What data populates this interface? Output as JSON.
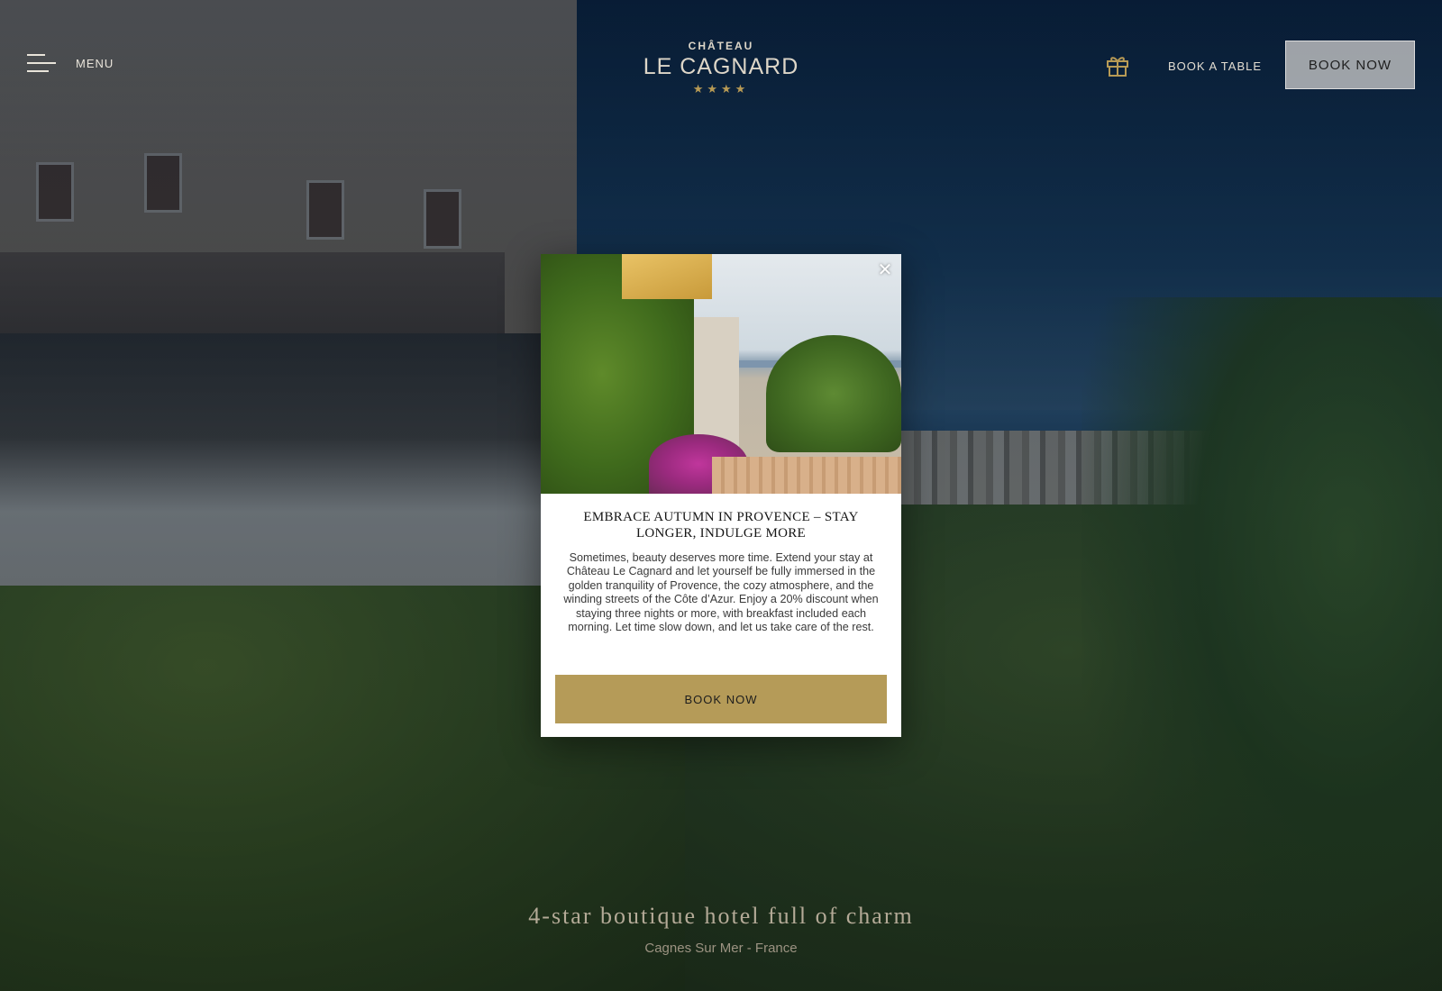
{
  "header": {
    "menu_label": "MENU",
    "logo": {
      "top": "CHÂTEAU",
      "main": "LE CAGNARD",
      "stars": "★★★★"
    },
    "gift_icon": "gift-icon",
    "book_table_label": "BOOK A TABLE",
    "book_now_label": "BOOK NOW"
  },
  "hero": {
    "title": "4-star boutique hotel full of charm",
    "subtitle": "Cagnes Sur Mer - France"
  },
  "modal": {
    "close_glyph": "✕",
    "title": "EMBRACE AUTUMN IN PROVENCE – STAY LONGER, INDULGE MORE",
    "body": "Sometimes, beauty deserves more time. Extend your stay at Château Le Cagnard and let yourself be fully immersed in the golden tranquility of Provence, the cozy atmosphere, and the winding streets of the Côte d’Azur. Enjoy a 20% discount when staying three nights or more, with breakfast included each morning. Let time slow down, and let us take care of the rest.",
    "cta_label": "BOOK NOW"
  },
  "colors": {
    "accent_gold": "#b59b58",
    "stars_gold": "#b79a55",
    "overlay": "#0a1a2a"
  }
}
